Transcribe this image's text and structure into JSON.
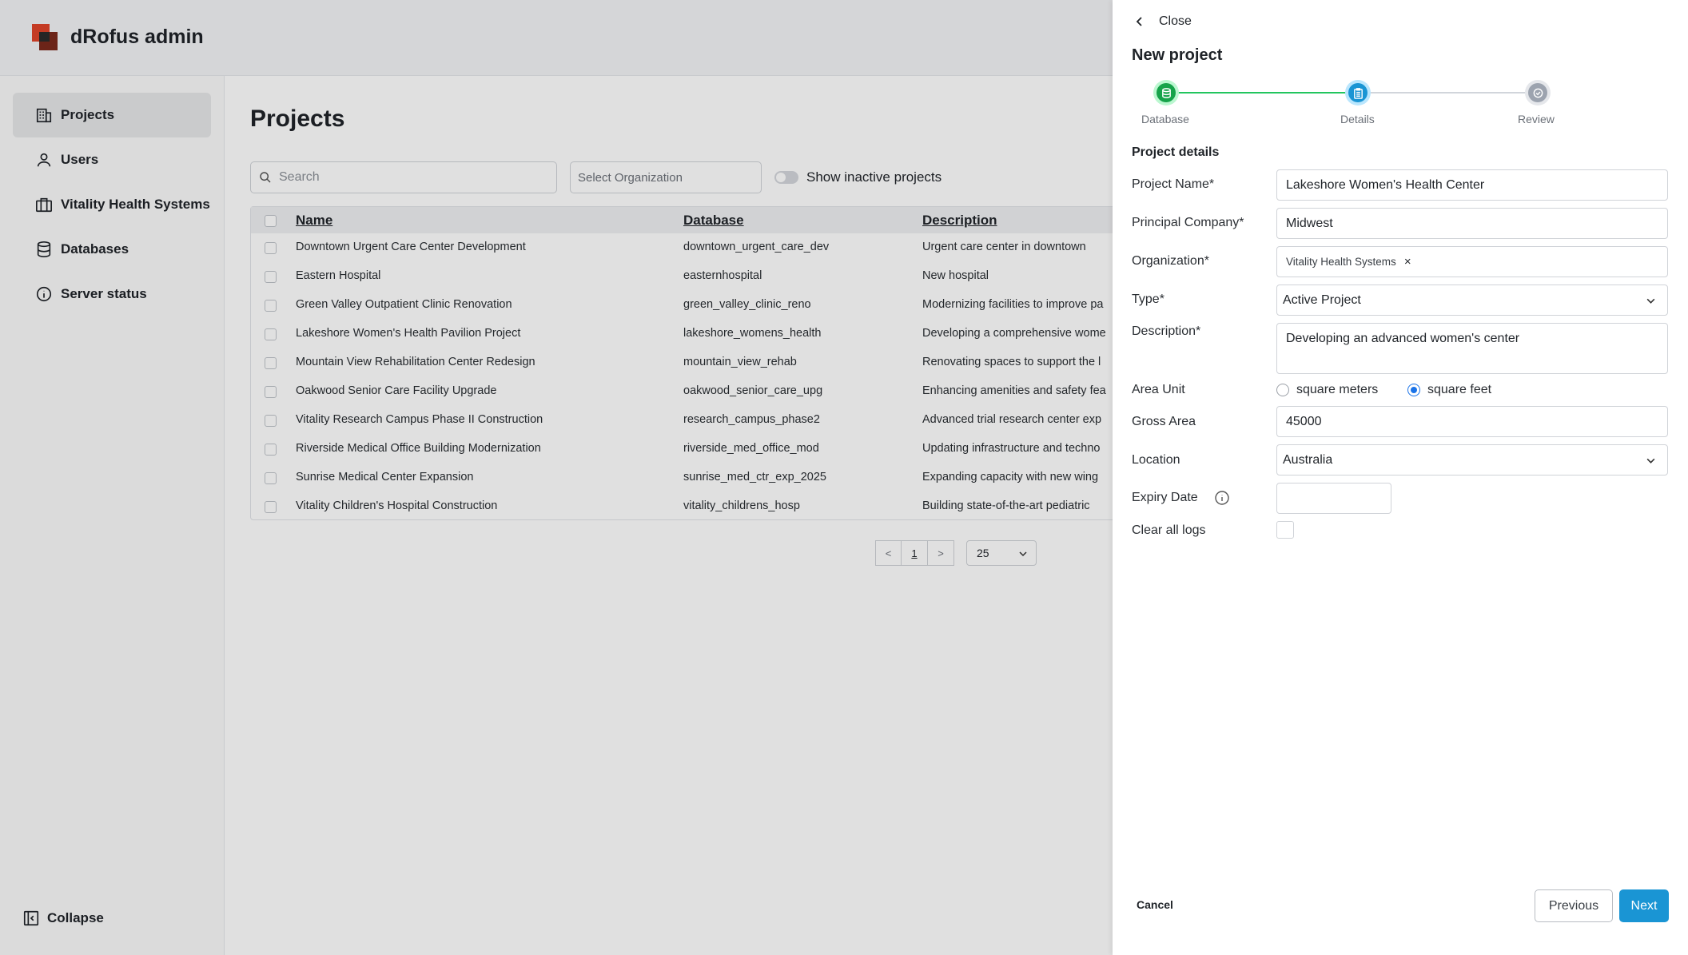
{
  "app": {
    "title": "dRofus admin"
  },
  "sidebar": {
    "items": [
      {
        "label": "Projects",
        "icon": "building-icon"
      },
      {
        "label": "Users",
        "icon": "user-icon"
      },
      {
        "label": "Vitality Health Systems",
        "icon": "briefcase-icon"
      },
      {
        "label": "Databases",
        "icon": "database-icon"
      },
      {
        "label": "Server status",
        "icon": "info-icon"
      }
    ],
    "collapse_label": "Collapse"
  },
  "main": {
    "title": "Projects",
    "search_placeholder": "Search",
    "org_placeholder": "Select Organization",
    "inactive_toggle_label": "Show inactive projects",
    "columns": [
      "Name",
      "Database",
      "Description"
    ],
    "rows": [
      {
        "name": "Downtown Urgent Care Center Development",
        "database": "downtown_urgent_care_dev",
        "description": "Urgent care center in downtown"
      },
      {
        "name": "Eastern Hospital",
        "database": "easternhospital",
        "description": "New hospital"
      },
      {
        "name": "Green Valley Outpatient Clinic Renovation",
        "database": "green_valley_clinic_reno",
        "description": "Modernizing facilities to improve pa"
      },
      {
        "name": "Lakeshore Women's Health Pavilion Project",
        "database": "lakeshore_womens_health",
        "description": "Developing a comprehensive wome"
      },
      {
        "name": "Mountain View Rehabilitation Center Redesign",
        "database": "mountain_view_rehab",
        "description": "Renovating spaces to support the l"
      },
      {
        "name": "Oakwood Senior Care Facility Upgrade",
        "database": "oakwood_senior_care_upg",
        "description": "Enhancing amenities and safety fea"
      },
      {
        "name": "Vitality Research Campus Phase II Construction",
        "database": "research_campus_phase2",
        "description": "Advanced trial research center exp"
      },
      {
        "name": "Riverside Medical Office Building Modernization",
        "database": "riverside_med_office_mod",
        "description": "Updating infrastructure and techno"
      },
      {
        "name": "Sunrise Medical Center Expansion",
        "database": "sunrise_med_ctr_exp_2025",
        "description": "Expanding capacity with new wing"
      },
      {
        "name": "Vitality Children's Hospital Construction",
        "database": "vitality_childrens_hosp",
        "description": "Building state-of-the-art pediatric"
      }
    ],
    "pagination": {
      "prev": "<",
      "page": "1",
      "next": ">",
      "per_page": "25"
    }
  },
  "drawer": {
    "close_label": "Close",
    "title": "New project",
    "steps": [
      {
        "label": "Database",
        "state": "complete"
      },
      {
        "label": "Details",
        "state": "current"
      },
      {
        "label": "Review",
        "state": "pending"
      }
    ],
    "section_title": "Project details",
    "fields": {
      "project_name": {
        "label": "Project Name*",
        "value": "Lakeshore Women's Health Center"
      },
      "principal_company": {
        "label": "Principal Company*",
        "value": "Midwest"
      },
      "organization": {
        "label": "Organization*",
        "tag": "Vitality Health Systems",
        "remove": "×"
      },
      "type": {
        "label": "Type*",
        "value": "Active Project"
      },
      "description": {
        "label": "Description*",
        "value": "Developing an advanced women's center"
      },
      "area_unit": {
        "label": "Area Unit",
        "options": [
          "square meters",
          "square feet"
        ],
        "selected": "square feet"
      },
      "gross_area": {
        "label": "Gross Area",
        "value": "45000"
      },
      "location": {
        "label": "Location",
        "value": "Australia"
      },
      "expiry_date": {
        "label": "Expiry Date",
        "value": ""
      },
      "clear_logs": {
        "label": "Clear all logs",
        "checked": false
      }
    },
    "buttons": {
      "cancel": "Cancel",
      "previous": "Previous",
      "next": "Next"
    }
  },
  "colors": {
    "accent": "#1a95d4",
    "step_complete": "#16a34a",
    "step_current": "#1a95d4",
    "step_pending": "#9ca3af",
    "logo": "#e0442a"
  }
}
